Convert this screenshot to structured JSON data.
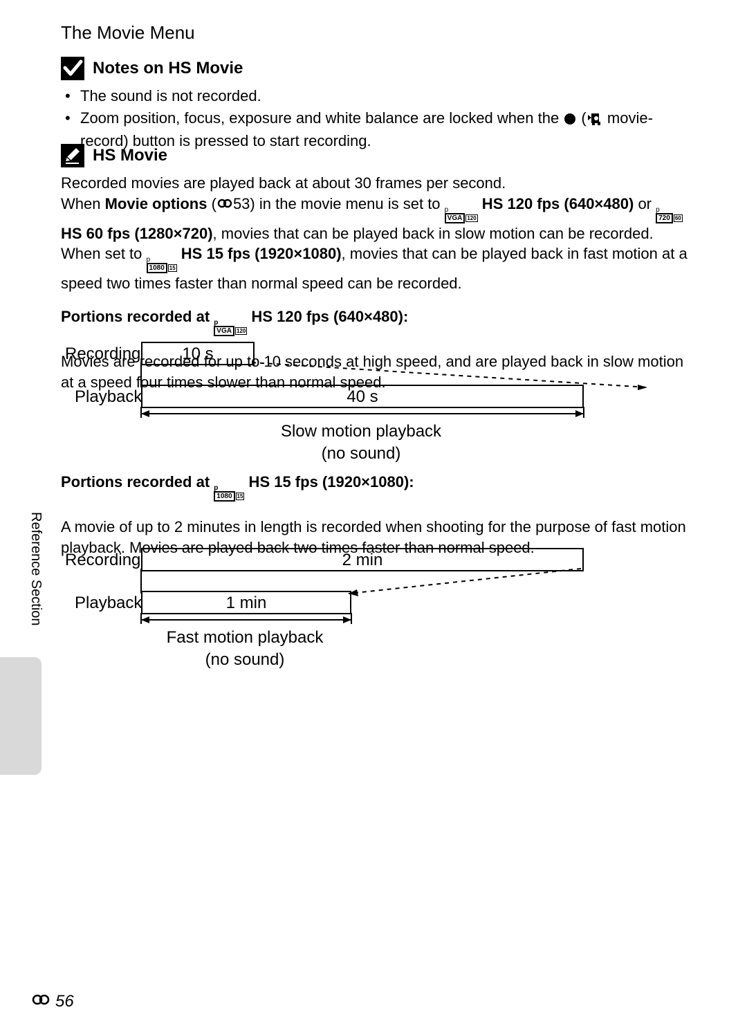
{
  "page_title": "The Movie Menu",
  "section1": {
    "heading": "Notes on HS Movie",
    "bullets": [
      "The sound is not recorded.",
      "Zoom position, focus, exposure and white balance are locked when the "
    ],
    "bullet2_tail": " movie-record) button is pressed to start recording."
  },
  "section2": {
    "heading": "HS Movie",
    "p1": "Recorded movies are played back at about 30 frames per second.",
    "p2a": "When ",
    "p2b": "Movie options",
    "p2c": " (",
    "xref": "53",
    "p2d": ") in the movie menu is set to ",
    "opt1": " HS 120 fps (640×480)",
    "p2e": " or ",
    "opt2": " HS 60 fps (1280×720)",
    "p2f": ", movies that can be played back in slow motion can be recorded.",
    "p3a": "When set to ",
    "opt3": " HS 15 fps (1920×1080)",
    "p3b": ", movies that can be played back in fast motion at a speed two times faster than normal speed can be recorded.",
    "sub1": "Portions recorded at ",
    "sub1b": " HS 120 fps (640×480):",
    "sub1_text": "Movies are recorded for up to 10 seconds at high speed, and are played back in slow motion at a speed four times slower than normal speed.",
    "sub2": "Portions recorded at ",
    "sub2b": " HS 15 fps (1920×1080):",
    "sub2_text": "A movie of up to 2 minutes in length is recorded when shooting for the purpose of fast motion playback. Movies are played back two times faster than normal speed."
  },
  "diagram1": {
    "recording": "Recording",
    "rec_time": "10 s",
    "playback": "Playback",
    "play_time": "40 s",
    "caption_l1": "Slow motion playback",
    "caption_l2": "(no sound)"
  },
  "diagram2": {
    "recording": "Recording",
    "rec_time": "2 min",
    "playback": "Playback",
    "play_time": "1 min",
    "caption_l1": "Fast motion playback",
    "caption_l2": "(no sound)"
  },
  "sidebar": "Reference Section",
  "page_number": "56",
  "icons": {
    "vga120": {
      "top": "p",
      "main": "VGA",
      "sub": "120"
    },
    "720_60": {
      "top": "p",
      "main": "720",
      "sub": "60"
    },
    "1080_15": {
      "top": "p",
      "main": "1080",
      "sub": "15"
    }
  }
}
